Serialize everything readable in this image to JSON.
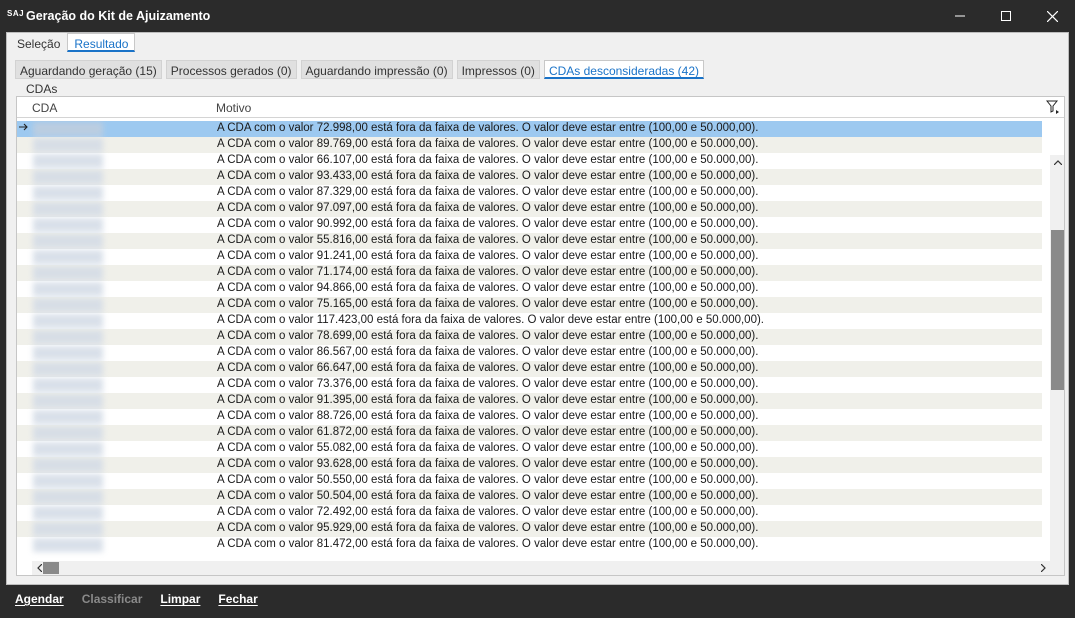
{
  "window": {
    "logo": "SAJ",
    "title": "Geração do Kit de Ajuizamento"
  },
  "tabs_top": [
    {
      "label": "Seleção",
      "active": false
    },
    {
      "label": "Resultado",
      "active": true
    }
  ],
  "tabs_inner": [
    {
      "label": "Aguardando geração (15)",
      "active": false
    },
    {
      "label": "Processos gerados (0)",
      "active": false
    },
    {
      "label": "Aguardando impressão (0)",
      "active": false
    },
    {
      "label": "Impressos (0)",
      "active": false
    },
    {
      "label": "CDAs desconsideradas (42)",
      "active": true
    }
  ],
  "group": {
    "label": "CDAs"
  },
  "grid": {
    "columns": [
      "CDA",
      "Motivo"
    ],
    "rows": [
      "A CDA com o valor 72.998,00 está fora da faixa de valores. O valor deve estar entre (100,00 e 50.000,00).",
      "A CDA com o valor 89.769,00 está fora da faixa de valores. O valor deve estar entre (100,00 e 50.000,00).",
      "A CDA com o valor 66.107,00 está fora da faixa de valores. O valor deve estar entre (100,00 e 50.000,00).",
      "A CDA com o valor 93.433,00 está fora da faixa de valores. O valor deve estar entre (100,00 e 50.000,00).",
      "A CDA com o valor 87.329,00 está fora da faixa de valores. O valor deve estar entre (100,00 e 50.000,00).",
      "A CDA com o valor 97.097,00 está fora da faixa de valores. O valor deve estar entre (100,00 e 50.000,00).",
      "A CDA com o valor 90.992,00 está fora da faixa de valores. O valor deve estar entre (100,00 e 50.000,00).",
      "A CDA com o valor 55.816,00 está fora da faixa de valores. O valor deve estar entre (100,00 e 50.000,00).",
      "A CDA com o valor 91.241,00 está fora da faixa de valores. O valor deve estar entre (100,00 e 50.000,00).",
      "A CDA com o valor 71.174,00 está fora da faixa de valores. O valor deve estar entre (100,00 e 50.000,00).",
      "A CDA com o valor 94.866,00 está fora da faixa de valores. O valor deve estar entre (100,00 e 50.000,00).",
      "A CDA com o valor 75.165,00 está fora da faixa de valores. O valor deve estar entre (100,00 e 50.000,00).",
      "A CDA com o valor 117.423,00 está fora da faixa de valores. O valor deve estar entre (100,00 e 50.000,00).",
      "A CDA com o valor 78.699,00 está fora da faixa de valores. O valor deve estar entre (100,00 e 50.000,00).",
      "A CDA com o valor 86.567,00 está fora da faixa de valores. O valor deve estar entre (100,00 e 50.000,00).",
      "A CDA com o valor 66.647,00 está fora da faixa de valores. O valor deve estar entre (100,00 e 50.000,00).",
      "A CDA com o valor 73.376,00 está fora da faixa de valores. O valor deve estar entre (100,00 e 50.000,00).",
      "A CDA com o valor 91.395,00 está fora da faixa de valores. O valor deve estar entre (100,00 e 50.000,00).",
      "A CDA com o valor 88.726,00 está fora da faixa de valores. O valor deve estar entre (100,00 e 50.000,00).",
      "A CDA com o valor 61.872,00 está fora da faixa de valores. O valor deve estar entre (100,00 e 50.000,00).",
      "A CDA com o valor 55.082,00 está fora da faixa de valores. O valor deve estar entre (100,00 e 50.000,00).",
      "A CDA com o valor 93.628,00 está fora da faixa de valores. O valor deve estar entre (100,00 e 50.000,00).",
      "A CDA com o valor 50.550,00 está fora da faixa de valores. O valor deve estar entre (100,00 e 50.000,00).",
      "A CDA com o valor 50.504,00 está fora da faixa de valores. O valor deve estar entre (100,00 e 50.000,00).",
      "A CDA com o valor 72.492,00 está fora da faixa de valores. O valor deve estar entre (100,00 e 50.000,00).",
      "A CDA com o valor 95.929,00 está fora da faixa de valores. O valor deve estar entre (100,00 e 50.000,00).",
      "A CDA com o valor 81.472,00 está fora da faixa de valores. O valor deve estar entre (100,00 e 50.000,00)."
    ],
    "selected_row": 0
  },
  "footer": {
    "agendar": "Agendar",
    "classificar": "Classificar",
    "limpar": "Limpar",
    "fechar": "Fechar"
  },
  "colors": {
    "accent": "#1a73c8",
    "selection": "#9dc9f0",
    "alt_row": "#f0f0ea",
    "chrome": "#2b2b2b"
  }
}
